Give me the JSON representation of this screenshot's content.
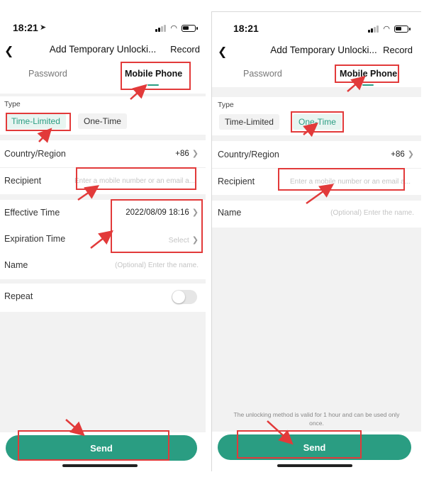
{
  "left": {
    "status": {
      "time": "18:21"
    },
    "nav": {
      "title": "Add Temporary Unlocki...",
      "record": "Record"
    },
    "tabs": [
      {
        "label": "Password"
      },
      {
        "label": "Mobile Phone"
      }
    ],
    "type_label": "Type",
    "type_options": [
      {
        "label": "Time-Limited",
        "selected": true
      },
      {
        "label": "One-Time",
        "selected": false
      }
    ],
    "country": {
      "label": "Country/Region",
      "value": "+86"
    },
    "recipient": {
      "label": "Recipient",
      "placeholder": "Enter a mobile number or an email a..."
    },
    "effective": {
      "label": "Effective Time",
      "value": "2022/08/09 18:16"
    },
    "expiration": {
      "label": "Expiration Time",
      "placeholder": "Select"
    },
    "name": {
      "label": "Name",
      "placeholder": "(Optional) Enter the name."
    },
    "repeat": {
      "label": "Repeat",
      "enabled": false
    },
    "send_label": "Send"
  },
  "right": {
    "status": {
      "time": "18:21"
    },
    "nav": {
      "title": "Add Temporary Unlocki...",
      "record": "Record"
    },
    "tabs": [
      {
        "label": "Password"
      },
      {
        "label": "Mobile Phone"
      }
    ],
    "type_label": "Type",
    "type_options": [
      {
        "label": "Time-Limited",
        "selected": false
      },
      {
        "label": "One-Time",
        "selected": true
      }
    ],
    "country": {
      "label": "Country/Region",
      "value": "+86"
    },
    "recipient": {
      "label": "Recipient",
      "placeholder": "Enter a mobile number or an email a..."
    },
    "name": {
      "label": "Name",
      "placeholder": "(Optional) Enter the name."
    },
    "note": "The unlocking method is valid for 1 hour and can be used only once.",
    "send_label": "Send"
  },
  "colors": {
    "accent": "#2a9d82",
    "annotation": "#e23a3a"
  }
}
